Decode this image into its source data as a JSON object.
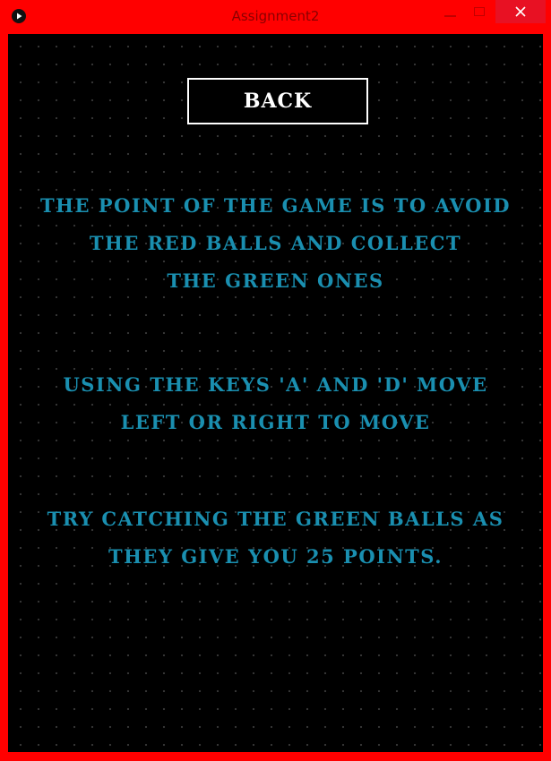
{
  "window": {
    "title": "Assignment2",
    "frame_color": "#ff0000",
    "close_button_color": "#e81123"
  },
  "icons": {
    "app": "play-icon",
    "minimize": "minimize-icon",
    "maximize": "maximize-icon",
    "close": "close-icon"
  },
  "screen": {
    "back_label": "BACK",
    "text_color": "#1a8fb0",
    "background": "#000000",
    "instructions": [
      {
        "lines": [
          "THE POINT OF THE GAME IS TO AVOID",
          "THE RED BALLS AND COLLECT",
          "THE GREEN ONES"
        ]
      },
      {
        "lines": [
          "USING THE KEYS 'A' AND 'D' MOVE",
          "LEFT OR RIGHT TO MOVE"
        ]
      },
      {
        "lines": [
          "TRY CATCHING THE GREEN BALLS AS",
          "THEY GIVE YOU 25 POINTS."
        ]
      }
    ]
  }
}
